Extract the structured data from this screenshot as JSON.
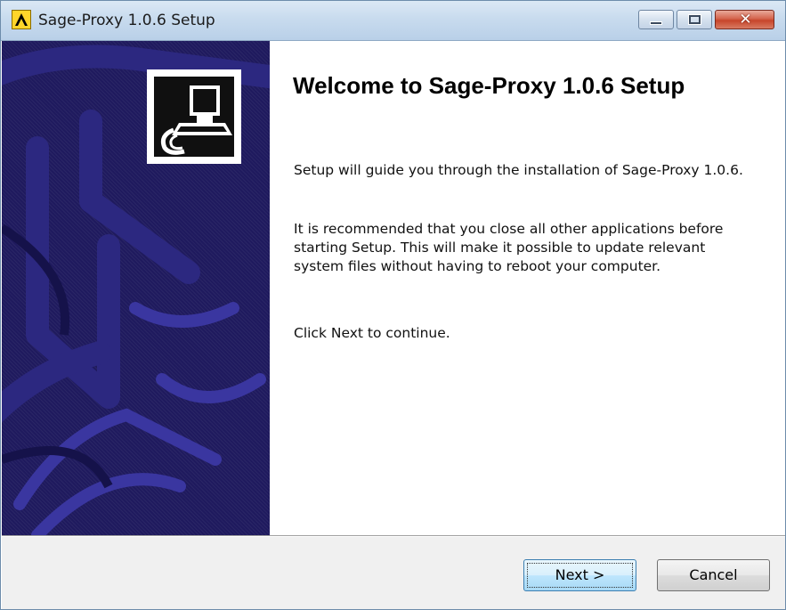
{
  "window": {
    "title": "Sage-Proxy 1.0.6 Setup",
    "app_icon": "installer-app-icon",
    "controls": {
      "minimize": "minimize-icon",
      "maximize": "maximize-icon",
      "close": "close-icon",
      "close_glyph": "✕"
    }
  },
  "banner": {
    "icon": "installer-computer-icon"
  },
  "content": {
    "heading": "Welcome to Sage-Proxy 1.0.6 Setup",
    "paragraphs": [
      "Setup will guide you through the installation of Sage-Proxy 1.0.6.",
      "It is recommended that you close all other applications before starting Setup. This will make it possible to update relevant system files without having to reboot your computer.",
      "Click Next to continue."
    ]
  },
  "buttons": {
    "next": "Next >",
    "cancel": "Cancel"
  },
  "colors": {
    "banner_bg": "#1f1a5e",
    "titlebar": "#c8dbee",
    "close_button": "#c7452b",
    "default_button_border": "#3c7fb1"
  }
}
